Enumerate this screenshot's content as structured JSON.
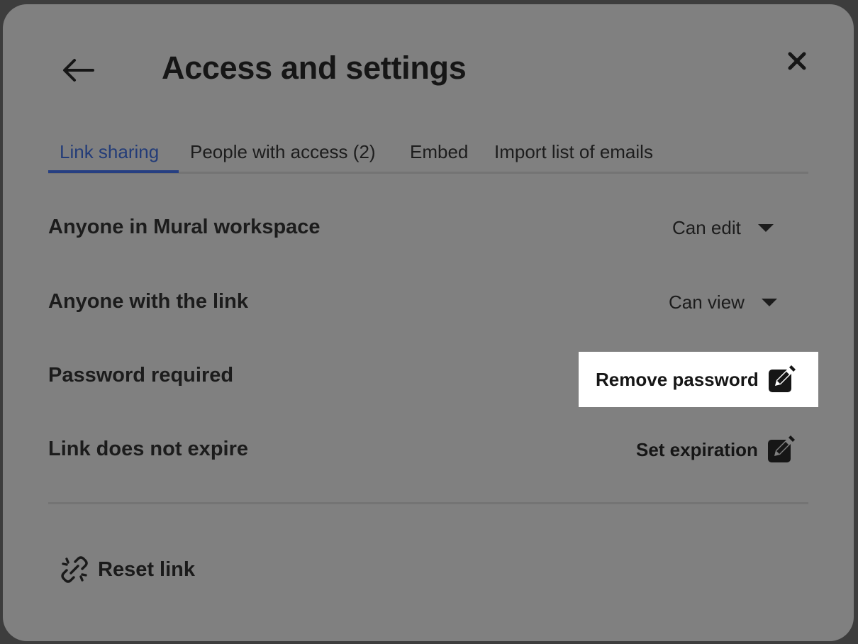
{
  "dialog": {
    "title": "Access and settings",
    "back_icon": "arrow-left-icon",
    "close_icon": "close-icon"
  },
  "tabs": [
    {
      "label": "Link sharing",
      "active": true
    },
    {
      "label": "People with access (2)",
      "active": false
    },
    {
      "label": "Embed",
      "active": false
    },
    {
      "label": "Import list of emails",
      "active": false
    }
  ],
  "rows": {
    "workspace": {
      "label": "Anyone in Mural workspace",
      "value": "Can edit"
    },
    "link": {
      "label": "Anyone with the link",
      "value": "Can view"
    },
    "password": {
      "label": "Password required",
      "action": "Remove password",
      "icon": "edit-icon"
    },
    "expiration": {
      "label": "Link does not expire",
      "action": "Set expiration",
      "icon": "edit-icon"
    }
  },
  "reset": {
    "label": "Reset link",
    "icon": "broken-link-icon"
  },
  "colors": {
    "overlay": "#808080",
    "accent_tab": "#263f82",
    "highlight": "#ffffff",
    "text": "#1c1c1c"
  }
}
